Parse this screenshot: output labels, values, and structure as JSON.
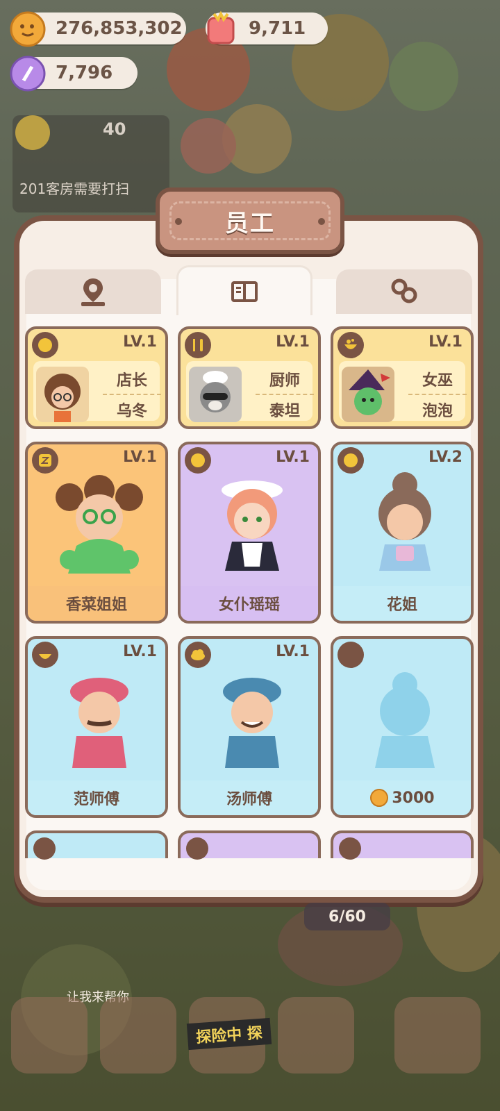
{
  "currency": {
    "cookies": "276,853,302",
    "gems": "9,711",
    "tickets": "7,796"
  },
  "status": {
    "count": "40",
    "room_notice": "201客房需要打扫"
  },
  "modal": {
    "title": "员工",
    "tabs": [
      {
        "icon": "map-pin-icon",
        "active": false
      },
      {
        "icon": "book-icon",
        "active": true
      },
      {
        "icon": "link-icon",
        "active": false
      }
    ]
  },
  "managers": [
    {
      "lv": "LV.1",
      "role": "店长",
      "name": "乌冬",
      "icon": "cookie-icon"
    },
    {
      "lv": "LV.1",
      "role": "厨师",
      "name": "泰坦",
      "icon": "utensils-icon"
    },
    {
      "lv": "LV.1",
      "role": "女巫",
      "name": "泡泡",
      "icon": "cauldron-icon"
    }
  ],
  "staff": [
    {
      "lv": "LV.1",
      "name": "香菜姐姐",
      "color": "orange"
    },
    {
      "lv": "LV.1",
      "name": "女仆瑶瑶",
      "color": "purple"
    },
    {
      "lv": "LV.2",
      "name": "花姐",
      "color": "blue"
    },
    {
      "lv": "LV.1",
      "name": "范师傅",
      "color": "blue"
    },
    {
      "lv": "LV.1",
      "name": "汤师傅",
      "color": "blue"
    },
    {
      "lv": "",
      "name": "",
      "price": "3000",
      "color": "blue",
      "locked": true
    }
  ],
  "bottom": {
    "room_progress": "6/60",
    "explore_label": "探险中 探",
    "help_text": "让我来帮你"
  }
}
